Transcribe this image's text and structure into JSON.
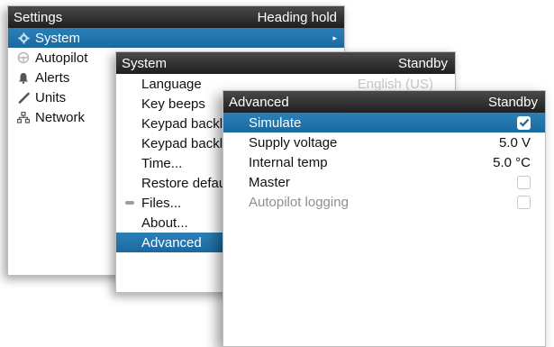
{
  "settings": {
    "title": "Settings",
    "status": "Heading hold",
    "items": [
      {
        "label": "System",
        "icon": "gear-icon"
      },
      {
        "label": "Autopilot",
        "icon": "helm-icon"
      },
      {
        "label": "Alerts",
        "icon": "bell-icon"
      },
      {
        "label": "Units",
        "icon": "ruler-icon"
      },
      {
        "label": "Network",
        "icon": "network-icon"
      }
    ]
  },
  "system": {
    "title": "System",
    "status": "Standby",
    "items": [
      {
        "label": "Language",
        "value": "English (US)"
      },
      {
        "label": "Key beeps"
      },
      {
        "label": "Keypad backl"
      },
      {
        "label": "Keypad backl"
      },
      {
        "label": "Time..."
      },
      {
        "label": "Restore defau"
      },
      {
        "label": "Files..."
      },
      {
        "label": "About..."
      },
      {
        "label": "Advanced"
      }
    ]
  },
  "advanced": {
    "title": "Advanced",
    "status": "Standby",
    "items": [
      {
        "label": "Simulate",
        "checked": true
      },
      {
        "label": "Supply voltage",
        "value": "5.0 V"
      },
      {
        "label": "Internal temp",
        "value": "5.0 °C"
      },
      {
        "label": "Master",
        "checked": false
      },
      {
        "label": "Autopilot logging",
        "checked": false
      }
    ]
  },
  "colors": {
    "selection": "#1a6aa2",
    "titlebar": "#2a2a2a",
    "disabled_text": "#8f8f8f"
  }
}
